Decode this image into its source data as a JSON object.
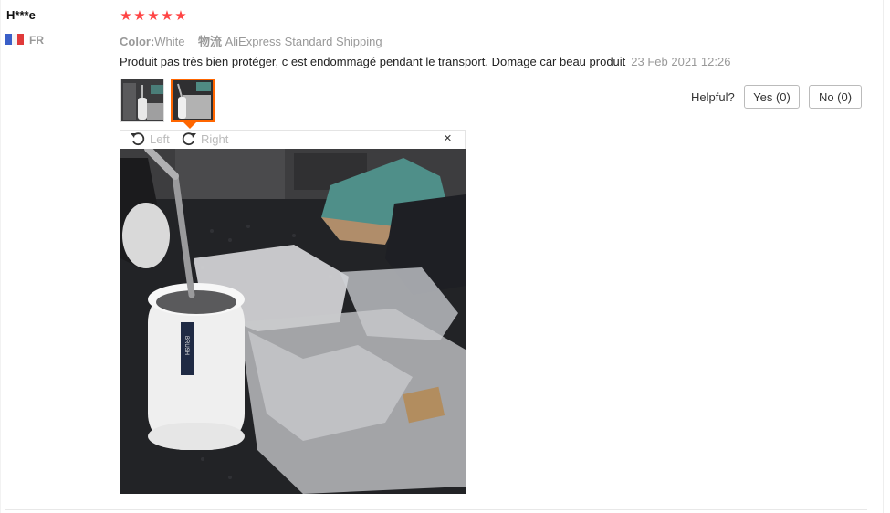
{
  "review": {
    "user_name": "H***e",
    "country": "FR",
    "rating_stars": 5,
    "color_label": "Color:",
    "color_value": "White",
    "shipping_label": "物流",
    "shipping_value": "AliExpress Standard Shipping",
    "text": "Produit pas très bien protéger, c est endommagé pendant le transport. Domage car beau produit",
    "date": "23 Feb 2021 12:26"
  },
  "helpful": {
    "label": "Helpful?",
    "yes_label": "Yes (0)",
    "no_label": "No (0)"
  },
  "viewer": {
    "rotate_left_label": "Left",
    "rotate_right_label": "Right",
    "close_glyph": "×",
    "photo_brand_text": "BRUSH"
  },
  "colors": {
    "star": "#ff4747",
    "selected_thumb_border": "#ff6600",
    "muted_text": "#999999"
  },
  "icons": [
    "star-icon",
    "france-flag-icon",
    "rotate-left-icon",
    "rotate-right-icon",
    "close-icon"
  ]
}
